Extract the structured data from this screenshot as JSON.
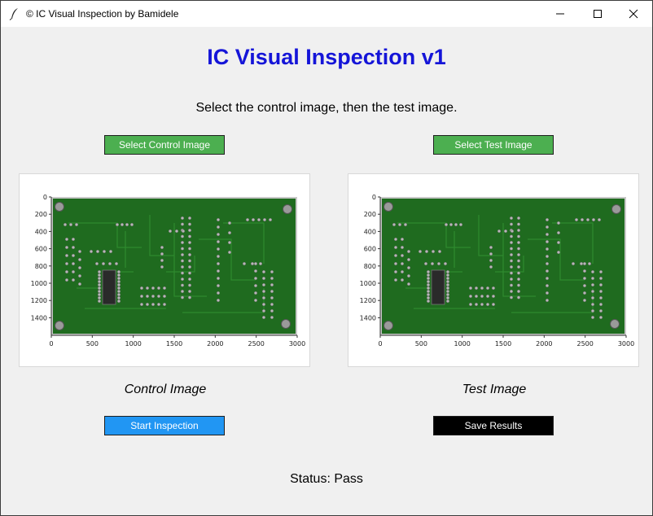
{
  "window": {
    "title": "© IC Visual Inspection by Bamidele",
    "controls": [
      "minimize-icon",
      "maximize-icon",
      "close-icon"
    ]
  },
  "heading": "IC Visual Inspection v1",
  "instruction": "Select the control image, then the test image.",
  "buttons": {
    "select_control": "Select Control Image",
    "select_test": "Select Test Image",
    "start_inspection": "Start Inspection",
    "save_results": "Save Results"
  },
  "images": {
    "control_caption": "Control Image",
    "test_caption": "Test Image",
    "x_ticks": [
      "0",
      "500",
      "1000",
      "1500",
      "2000",
      "2500",
      "3000"
    ],
    "y_ticks": [
      "0",
      "200",
      "400",
      "600",
      "800",
      "1000",
      "1200",
      "1400"
    ]
  },
  "status": "Status: Pass",
  "colors": {
    "heading": "#1515d8",
    "green_button": "#4caf50",
    "blue_button": "#2196f3",
    "black_button": "#000000",
    "pcb": "#1f6b1f"
  }
}
